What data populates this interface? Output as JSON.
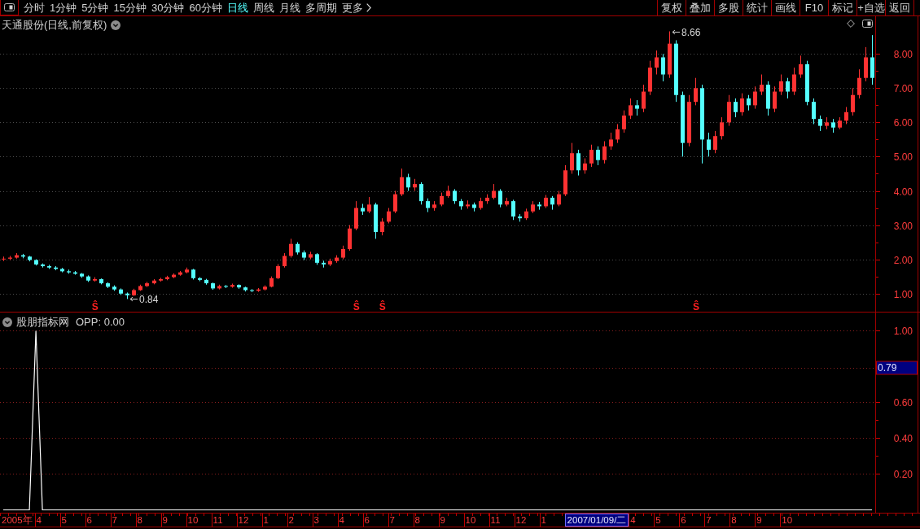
{
  "toolbar": {
    "tabs": [
      {
        "label": "分时",
        "selected": false,
        "kind": "period"
      },
      {
        "label": "1分钟",
        "selected": false,
        "kind": "period"
      },
      {
        "label": "5分钟",
        "selected": false,
        "kind": "period"
      },
      {
        "label": "15分钟",
        "selected": false,
        "kind": "period"
      },
      {
        "label": "30分钟",
        "selected": false,
        "kind": "period"
      },
      {
        "label": "60分钟",
        "selected": false,
        "kind": "period"
      },
      {
        "label": "日线",
        "selected": true,
        "kind": "period"
      },
      {
        "label": "周线",
        "selected": false,
        "kind": "period"
      },
      {
        "label": "月线",
        "selected": false,
        "kind": "period"
      },
      {
        "label": "多周期",
        "selected": false,
        "kind": "period"
      },
      {
        "label": "更多",
        "selected": false,
        "kind": "menu"
      }
    ],
    "buttons": [
      "复权",
      "叠加",
      "多股",
      "统计",
      "画线",
      "F10",
      "标记",
      "+自选",
      "返回"
    ]
  },
  "price_pane": {
    "title": "天通股份(日线,前复权)",
    "chart_data": [
      {
        "type": "candlestick",
        "ylim": [
          0.47,
          9.1
        ],
        "yticks": [
          {
            "value": 1,
            "label": "1.00"
          },
          {
            "value": 2,
            "label": "2.00"
          },
          {
            "value": 3,
            "label": "3.00"
          },
          {
            "value": 4,
            "label": "4.00"
          },
          {
            "value": 5,
            "label": "5.00"
          },
          {
            "value": 6,
            "label": "6.00"
          },
          {
            "value": 7,
            "label": "7.00"
          },
          {
            "value": 8,
            "label": "8.00"
          }
        ],
        "grid": true,
        "categories": [
          null,
          null,
          null,
          null,
          null,
          null,
          null,
          null,
          null,
          null,
          null,
          null,
          null,
          null,
          "Ŝ",
          null,
          null,
          null,
          null,
          null,
          null,
          null,
          null,
          null,
          null,
          null,
          null,
          null,
          null,
          null,
          null,
          null,
          null,
          null,
          null,
          null,
          null,
          null,
          null,
          null,
          null,
          null,
          null,
          null,
          null,
          null,
          null,
          null,
          null,
          null,
          null,
          null,
          null,
          null,
          "Ŝ",
          null,
          null,
          null,
          "Ŝ",
          null,
          null,
          null,
          null,
          null,
          null,
          null,
          null,
          null,
          null,
          null,
          null,
          null,
          null,
          null,
          null,
          null,
          null,
          null,
          null,
          null,
          null,
          null,
          null,
          null,
          null,
          null,
          null,
          null,
          null,
          null,
          null,
          null,
          null,
          null,
          null,
          null,
          null,
          null,
          null,
          null,
          null,
          null,
          null,
          null,
          null,
          null,
          "Ŝ",
          null,
          null,
          null,
          null,
          null,
          null,
          null,
          null,
          null,
          null,
          null,
          null,
          null,
          null,
          null,
          null,
          null,
          null,
          null,
          null,
          null,
          null,
          null,
          null,
          null,
          null,
          null
        ],
        "ohlc": [
          [
            2.0,
            2.08,
            1.95,
            2.02
          ],
          [
            2.02,
            2.1,
            1.98,
            2.05
          ],
          [
            2.05,
            2.18,
            2.02,
            2.12
          ],
          [
            2.12,
            2.16,
            2.03,
            2.08
          ],
          [
            2.08,
            2.1,
            1.94,
            1.98
          ],
          [
            1.98,
            2.0,
            1.82,
            1.85
          ],
          [
            1.85,
            1.88,
            1.76,
            1.8
          ],
          [
            1.8,
            1.84,
            1.72,
            1.76
          ],
          [
            1.76,
            1.8,
            1.68,
            1.72
          ],
          [
            1.72,
            1.75,
            1.62,
            1.65
          ],
          [
            1.65,
            1.7,
            1.58,
            1.62
          ],
          [
            1.62,
            1.66,
            1.55,
            1.58
          ],
          [
            1.58,
            1.6,
            1.46,
            1.5
          ],
          [
            1.5,
            1.53,
            1.34,
            1.38
          ],
          [
            1.38,
            1.48,
            1.35,
            1.42
          ],
          [
            1.42,
            1.44,
            1.27,
            1.3
          ],
          [
            1.3,
            1.33,
            1.16,
            1.2
          ],
          [
            1.2,
            1.24,
            1.08,
            1.12
          ],
          [
            1.12,
            1.15,
            0.96,
            1.0
          ],
          [
            1.0,
            1.03,
            0.84,
            0.95
          ],
          [
            0.95,
            1.14,
            0.93,
            1.1
          ],
          [
            1.1,
            1.26,
            1.08,
            1.22
          ],
          [
            1.22,
            1.34,
            1.19,
            1.3
          ],
          [
            1.3,
            1.42,
            1.27,
            1.38
          ],
          [
            1.38,
            1.46,
            1.35,
            1.42
          ],
          [
            1.42,
            1.52,
            1.39,
            1.48
          ],
          [
            1.48,
            1.59,
            1.45,
            1.55
          ],
          [
            1.55,
            1.66,
            1.52,
            1.62
          ],
          [
            1.62,
            1.76,
            1.59,
            1.7
          ],
          [
            1.7,
            1.72,
            1.41,
            1.45
          ],
          [
            1.45,
            1.48,
            1.36,
            1.4
          ],
          [
            1.4,
            1.43,
            1.26,
            1.3
          ],
          [
            1.3,
            1.32,
            1.11,
            1.15
          ],
          [
            1.15,
            1.26,
            1.12,
            1.22
          ],
          [
            1.22,
            1.25,
            1.16,
            1.2
          ],
          [
            1.2,
            1.29,
            1.17,
            1.25
          ],
          [
            1.25,
            1.27,
            1.14,
            1.18
          ],
          [
            1.18,
            1.2,
            1.06,
            1.1
          ],
          [
            1.1,
            1.13,
            1.04,
            1.08
          ],
          [
            1.08,
            1.16,
            1.05,
            1.12
          ],
          [
            1.12,
            1.24,
            1.09,
            1.2
          ],
          [
            1.2,
            1.5,
            1.18,
            1.45
          ],
          [
            1.45,
            1.86,
            1.42,
            1.8
          ],
          [
            1.8,
            2.18,
            1.76,
            2.1
          ],
          [
            2.1,
            2.6,
            2.05,
            2.45
          ],
          [
            2.45,
            2.5,
            2.14,
            2.2
          ],
          [
            2.2,
            2.26,
            1.98,
            2.05
          ],
          [
            2.05,
            2.22,
            2.0,
            2.15
          ],
          [
            2.15,
            2.18,
            1.84,
            1.9
          ],
          [
            1.9,
            1.96,
            1.76,
            1.85
          ],
          [
            1.85,
            2.02,
            1.8,
            1.95
          ],
          [
            1.95,
            2.12,
            1.9,
            2.05
          ],
          [
            2.05,
            2.4,
            2.0,
            2.3
          ],
          [
            2.3,
            3.0,
            2.25,
            2.9
          ],
          [
            2.9,
            3.7,
            2.85,
            3.5
          ],
          [
            3.5,
            3.62,
            3.3,
            3.4
          ],
          [
            3.4,
            3.82,
            3.35,
            3.6
          ],
          [
            3.6,
            3.65,
            2.6,
            2.8
          ],
          [
            2.8,
            3.2,
            2.7,
            3.1
          ],
          [
            3.1,
            3.5,
            3.05,
            3.4
          ],
          [
            3.4,
            4.0,
            3.35,
            3.9
          ],
          [
            3.9,
            4.65,
            3.85,
            4.4
          ],
          [
            4.4,
            4.5,
            4.0,
            4.1
          ],
          [
            4.1,
            4.35,
            4.0,
            4.2
          ],
          [
            4.2,
            4.25,
            3.6,
            3.7
          ],
          [
            3.7,
            3.78,
            3.38,
            3.5
          ],
          [
            3.5,
            3.7,
            3.42,
            3.6
          ],
          [
            3.6,
            3.95,
            3.55,
            3.85
          ],
          [
            3.85,
            4.15,
            3.8,
            4.0
          ],
          [
            4.0,
            4.05,
            3.62,
            3.7
          ],
          [
            3.7,
            3.76,
            3.45,
            3.55
          ],
          [
            3.55,
            3.72,
            3.48,
            3.6
          ],
          [
            3.6,
            3.66,
            3.4,
            3.5
          ],
          [
            3.5,
            3.8,
            3.45,
            3.7
          ],
          [
            3.7,
            3.9,
            3.62,
            3.8
          ],
          [
            3.8,
            4.2,
            3.75,
            4.0
          ],
          [
            4.0,
            4.05,
            3.52,
            3.6
          ],
          [
            3.6,
            3.8,
            3.55,
            3.7
          ],
          [
            3.7,
            3.74,
            3.15,
            3.25
          ],
          [
            3.25,
            3.32,
            3.1,
            3.2
          ],
          [
            3.2,
            3.48,
            3.15,
            3.4
          ],
          [
            3.4,
            3.7,
            3.35,
            3.6
          ],
          [
            3.6,
            3.68,
            3.45,
            3.55
          ],
          [
            3.55,
            3.88,
            3.5,
            3.8
          ],
          [
            3.8,
            3.85,
            3.45,
            3.6
          ],
          [
            3.6,
            4.0,
            3.55,
            3.9
          ],
          [
            3.9,
            4.75,
            3.85,
            4.6
          ],
          [
            4.6,
            5.4,
            4.5,
            5.1
          ],
          [
            5.1,
            5.2,
            4.45,
            4.6
          ],
          [
            4.6,
            4.95,
            4.5,
            4.8
          ],
          [
            4.8,
            5.35,
            4.7,
            5.2
          ],
          [
            5.2,
            5.3,
            4.75,
            4.9
          ],
          [
            4.9,
            5.45,
            4.8,
            5.3
          ],
          [
            5.3,
            5.7,
            5.2,
            5.5
          ],
          [
            5.5,
            5.95,
            5.4,
            5.8
          ],
          [
            5.8,
            6.35,
            5.7,
            6.2
          ],
          [
            6.2,
            6.7,
            6.1,
            6.5
          ],
          [
            6.5,
            6.65,
            6.2,
            6.4
          ],
          [
            6.4,
            7.1,
            6.3,
            6.9
          ],
          [
            6.9,
            7.8,
            6.8,
            7.6
          ],
          [
            7.6,
            8.1,
            7.4,
            7.9
          ],
          [
            7.9,
            8.0,
            7.2,
            7.4
          ],
          [
            7.4,
            8.66,
            7.3,
            8.3
          ],
          [
            8.3,
            8.4,
            6.6,
            6.8
          ],
          [
            6.8,
            6.9,
            5.0,
            5.4
          ],
          [
            5.4,
            6.8,
            5.3,
            6.6
          ],
          [
            6.6,
            7.3,
            6.5,
            7.0
          ],
          [
            7.0,
            7.1,
            4.8,
            5.5
          ],
          [
            5.5,
            5.7,
            5.0,
            5.2
          ],
          [
            5.2,
            5.75,
            5.1,
            5.6
          ],
          [
            5.6,
            6.15,
            5.5,
            6.0
          ],
          [
            6.0,
            6.8,
            5.9,
            6.6
          ],
          [
            6.6,
            6.7,
            6.15,
            6.3
          ],
          [
            6.3,
            6.85,
            6.2,
            6.7
          ],
          [
            6.7,
            6.8,
            6.35,
            6.5
          ],
          [
            6.5,
            7.05,
            6.4,
            6.9
          ],
          [
            6.9,
            7.4,
            6.8,
            7.1
          ],
          [
            7.1,
            7.2,
            6.2,
            6.4
          ],
          [
            6.4,
            7.05,
            6.3,
            6.9
          ],
          [
            6.9,
            7.4,
            6.8,
            7.2
          ],
          [
            7.2,
            7.3,
            6.7,
            6.9
          ],
          [
            6.9,
            7.6,
            6.8,
            7.4
          ],
          [
            7.4,
            7.95,
            7.3,
            7.7
          ],
          [
            7.7,
            7.8,
            6.5,
            6.6
          ],
          [
            6.6,
            6.7,
            5.95,
            6.1
          ],
          [
            6.1,
            6.2,
            5.75,
            5.9
          ],
          [
            5.9,
            6.15,
            5.8,
            6.0
          ],
          [
            6.0,
            6.1,
            5.7,
            5.85
          ],
          [
            5.85,
            6.15,
            5.8,
            6.05
          ],
          [
            6.05,
            6.45,
            5.95,
            6.3
          ],
          [
            6.3,
            7.0,
            6.2,
            6.8
          ],
          [
            6.8,
            7.55,
            6.7,
            7.3
          ],
          [
            7.3,
            8.2,
            7.2,
            7.9
          ],
          [
            7.9,
            8.55,
            7.1,
            7.3
          ]
        ],
        "annotations": [
          "8.66",
          "0.84"
        ]
      }
    ]
  },
  "indicator_pane": {
    "name": "股朋指标网",
    "reading": "OPP: 0.00",
    "chart_data": [
      {
        "type": "line",
        "color": "#ffffff",
        "ylim": [
          -0.02,
          1.1
        ],
        "yticks": [
          {
            "value": 0.2,
            "label": "0.20"
          },
          {
            "value": 0.4,
            "label": "0.40"
          },
          {
            "value": 0.6,
            "label": "0.60"
          },
          {
            "value": 1,
            "label": "1.00"
          }
        ],
        "tick_labels": "y",
        "grid": true,
        "values": [
          0,
          0,
          0,
          0,
          0,
          1,
          0,
          0,
          0,
          0,
          0,
          0,
          0,
          0,
          0,
          0,
          0,
          0,
          0,
          0,
          0,
          0,
          0,
          0,
          0,
          0,
          0,
          0,
          0,
          0,
          0,
          0,
          0,
          0,
          0,
          0,
          0,
          0,
          0,
          0,
          0,
          0,
          0,
          0,
          0,
          0,
          0,
          0,
          0,
          0,
          0,
          0,
          0,
          0,
          0,
          0,
          0,
          0,
          0,
          0,
          0,
          0,
          0,
          0,
          0,
          0,
          0,
          0,
          0,
          0,
          0,
          0,
          0,
          0,
          0,
          0,
          0,
          0,
          0,
          0,
          0,
          0,
          0,
          0,
          0,
          0,
          0,
          0,
          0,
          0,
          0,
          0,
          0,
          0,
          0,
          0,
          0,
          0,
          0,
          0,
          0,
          0,
          0,
          0,
          0,
          0,
          0,
          0,
          0,
          0,
          0,
          0,
          0,
          0,
          0,
          0,
          0,
          0,
          0,
          0,
          0,
          0,
          0,
          0,
          0,
          0,
          0,
          0,
          0,
          0,
          0,
          0,
          0,
          0
        ],
        "ref_lines": [
          {
            "axis": "y",
            "value": 0.79,
            "label": "0.79",
            "color": "#8a1e1e",
            "line_style": "dotted"
          }
        ]
      }
    ]
  },
  "time_axis": [
    {
      "label": "2005年",
      "selected": false
    },
    {
      "label": "4",
      "selected": false
    },
    {
      "label": "5",
      "selected": false
    },
    {
      "label": "6",
      "selected": false
    },
    {
      "label": "7",
      "selected": false
    },
    {
      "label": "8",
      "selected": false
    },
    {
      "label": "9",
      "selected": false
    },
    {
      "label": "10",
      "selected": false
    },
    {
      "label": "11",
      "selected": false
    },
    {
      "label": "12",
      "selected": false
    },
    {
      "label": "1",
      "selected": false
    },
    {
      "label": "2",
      "selected": false
    },
    {
      "label": "3",
      "selected": false
    },
    {
      "label": "4",
      "selected": false
    },
    {
      "label": "6",
      "selected": false
    },
    {
      "label": "7",
      "selected": false
    },
    {
      "label": "8",
      "selected": false
    },
    {
      "label": "9",
      "selected": false
    },
    {
      "label": "10",
      "selected": false
    },
    {
      "label": "11",
      "selected": false
    },
    {
      "label": "12",
      "selected": false
    },
    {
      "label": "1",
      "selected": false
    },
    {
      "label": "2007/01/09/二",
      "selected": true
    },
    {
      "label": "4",
      "selected": false
    },
    {
      "label": "5",
      "selected": false
    },
    {
      "label": "6",
      "selected": false
    },
    {
      "label": "7",
      "selected": false
    },
    {
      "label": "8",
      "selected": false
    },
    {
      "label": "9",
      "selected": false
    },
    {
      "label": "10",
      "selected": false
    }
  ]
}
